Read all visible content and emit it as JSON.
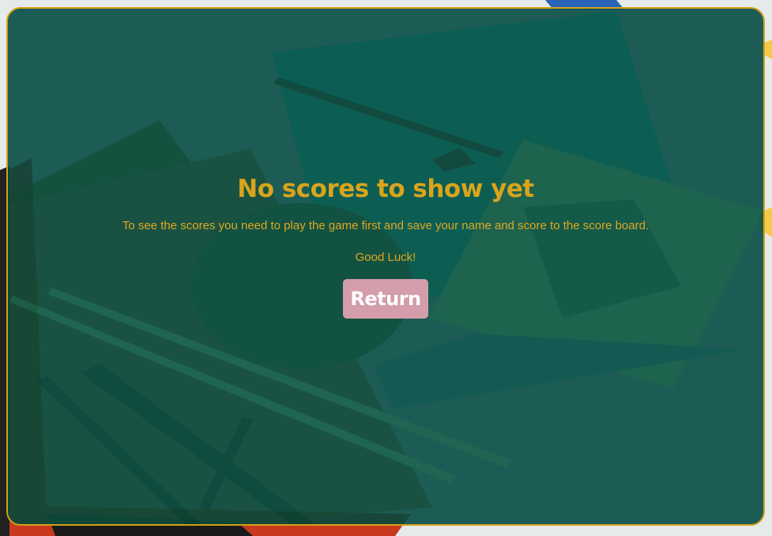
{
  "scoreboard": {
    "title": "No scores to show yet",
    "message": "To see the scores you need to play the game first and save your name and score to the score board.",
    "luck": "Good Luck!",
    "return_label": "Return"
  },
  "colors": {
    "accent": "#d9a41c",
    "panel": "#004840",
    "button": "#d49dab",
    "button_text": "#ffffff"
  }
}
